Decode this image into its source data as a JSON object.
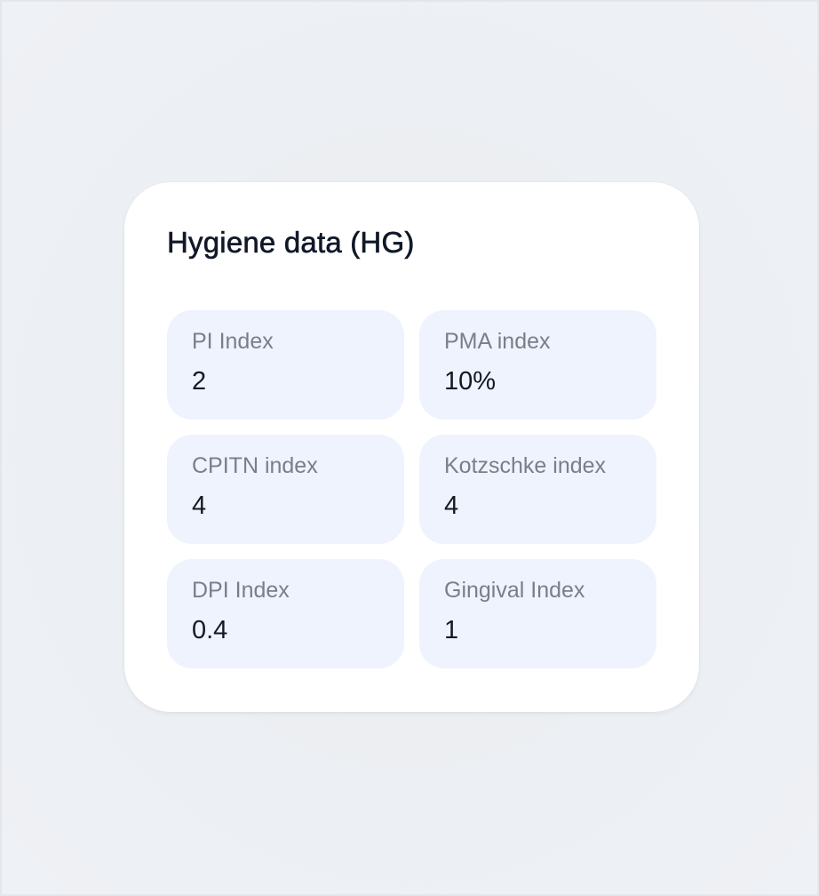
{
  "card": {
    "title": "Hygiene data (HG)",
    "metrics": [
      {
        "label": "PI Index",
        "value": "2"
      },
      {
        "label": "PMA index",
        "value": "10%"
      },
      {
        "label": "CPITN index",
        "value": "4"
      },
      {
        "label": "Kotzschke index",
        "value": "4"
      },
      {
        "label": "DPI Index",
        "value": "0.4"
      },
      {
        "label": "Gingival Index",
        "value": "1"
      }
    ]
  },
  "colors": {
    "page_background": "#eef1f5",
    "card_background": "#ffffff",
    "tile_background": "#eef3fd",
    "label_text": "#7a7e87",
    "value_text": "#141821",
    "title_text": "#101828"
  }
}
